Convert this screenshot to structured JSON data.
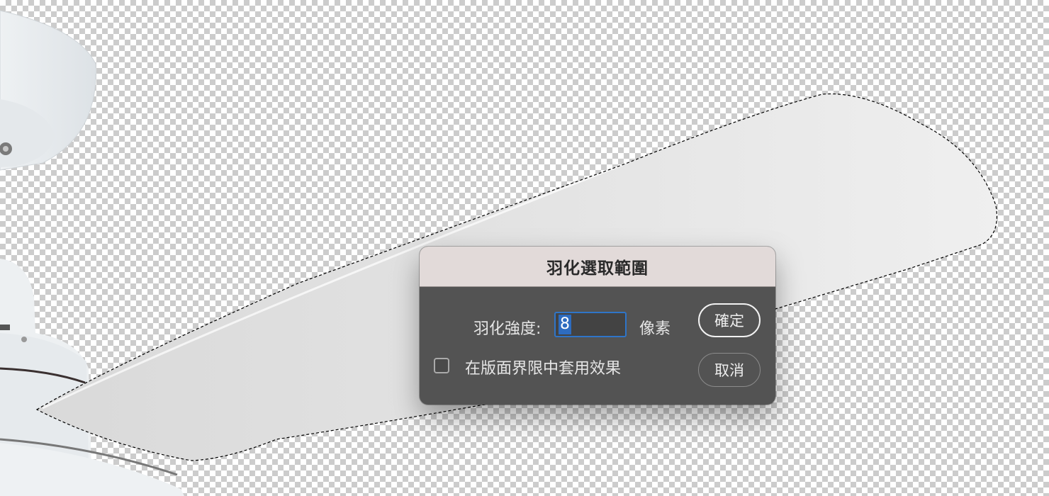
{
  "dialog": {
    "title": "羽化選取範圍",
    "feather_label": "羽化強度:",
    "feather_value": "8",
    "unit_label": "像素",
    "apply_canvas_label": "在版面界限中套用效果",
    "apply_canvas_checked": false,
    "ok_label": "確定",
    "cancel_label": "取消"
  },
  "colors": {
    "dialog_bg": "#535353",
    "titlebar_bg": "#e2dad9",
    "focus_accent": "#2f75c8"
  }
}
